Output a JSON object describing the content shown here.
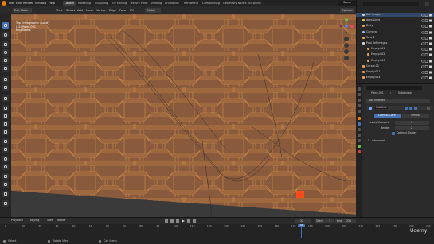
{
  "app": {
    "brand_color": "#e87d0d",
    "accent": "#4772b3",
    "mesh_face_color": "#8a5a3d",
    "mesh_edge_color": "#f3a44a"
  },
  "topbar": {
    "menus": [
      "File",
      "Edit",
      "Render",
      "Window",
      "Help"
    ],
    "tabs": [
      "Layout",
      "Modeling",
      "Sculpting",
      "UV Editing",
      "Texture Paint",
      "Shading",
      "Animation",
      "Rendering",
      "Compositing",
      "Geometry Nodes",
      "Scripting"
    ],
    "active_tab": "Layout",
    "scene_label": "Scene",
    "view_layer_label": "ViewLayer"
  },
  "header2": {
    "mode": "Edit Mode",
    "menus": [
      "View",
      "Select",
      "Add",
      "Mesh",
      "Vertex",
      "Edge",
      "Face",
      "UV"
    ],
    "transform": "Global",
    "options": "Options"
  },
  "viewport_overlay": {
    "line1": "Top Orthographic (Local)",
    "line2": "(32) Plane.001",
    "line3": "Millimeters"
  },
  "outliner": {
    "items": [
      {
        "name": "Ref. Images",
        "color": "#d3d3d3"
      },
      {
        "name": "Area Light",
        "color": "#e6c35c"
      },
      {
        "name": "Body",
        "color": "#e8a050"
      },
      {
        "name": "Camera",
        "color": "#9bb3d4"
      },
      {
        "name": "Tone 2",
        "color": "#e8a050"
      },
      {
        "name": "Pool Ref Images",
        "color": "#d3d3d3"
      },
      {
        "name": "Empty.001",
        "color": "#e8a050"
      },
      {
        "name": "Empty.002",
        "color": "#e8a050"
      },
      {
        "name": "Empty.003",
        "color": "#e8a050"
      },
      {
        "name": "Cursor.00",
        "color": "#e8a050"
      },
      {
        "name": "Empty.011",
        "color": "#e8a050"
      },
      {
        "name": "Empty.014",
        "color": "#e8a050"
      }
    ]
  },
  "properties": {
    "object_name": "Plane.001",
    "modifier_stack": "Subdivision",
    "add_modifier": "Add Modifier",
    "modifier_name": "Subdivis",
    "catmull": "Catmull-Clark",
    "simple": "Simple",
    "levels_label": "Levels Viewport",
    "levels_value": "1",
    "render_label": "Render",
    "render_value": "2",
    "optimal_display": "Optimal Display",
    "advanced": "Advanced"
  },
  "timeline": {
    "menu": [
      "Playback",
      "Keying",
      "View",
      "Marker"
    ],
    "current_frame": "32",
    "start_label": "Start",
    "start_value": "1",
    "end_label": "End",
    "end_value": "250",
    "ticks": [
      "0",
      "10",
      "20",
      "30",
      "40",
      "50",
      "60",
      "70",
      "80",
      "90",
      "100",
      "110",
      "120",
      "130",
      "140",
      "150",
      "160",
      "170",
      "180",
      "190",
      "200",
      "210",
      "220",
      "230",
      "240",
      "250"
    ]
  },
  "statusbar": {
    "select": "Select",
    "rotate_view": "Rotate View",
    "call_menu": "Call Menu"
  },
  "watermark": "Udemy"
}
